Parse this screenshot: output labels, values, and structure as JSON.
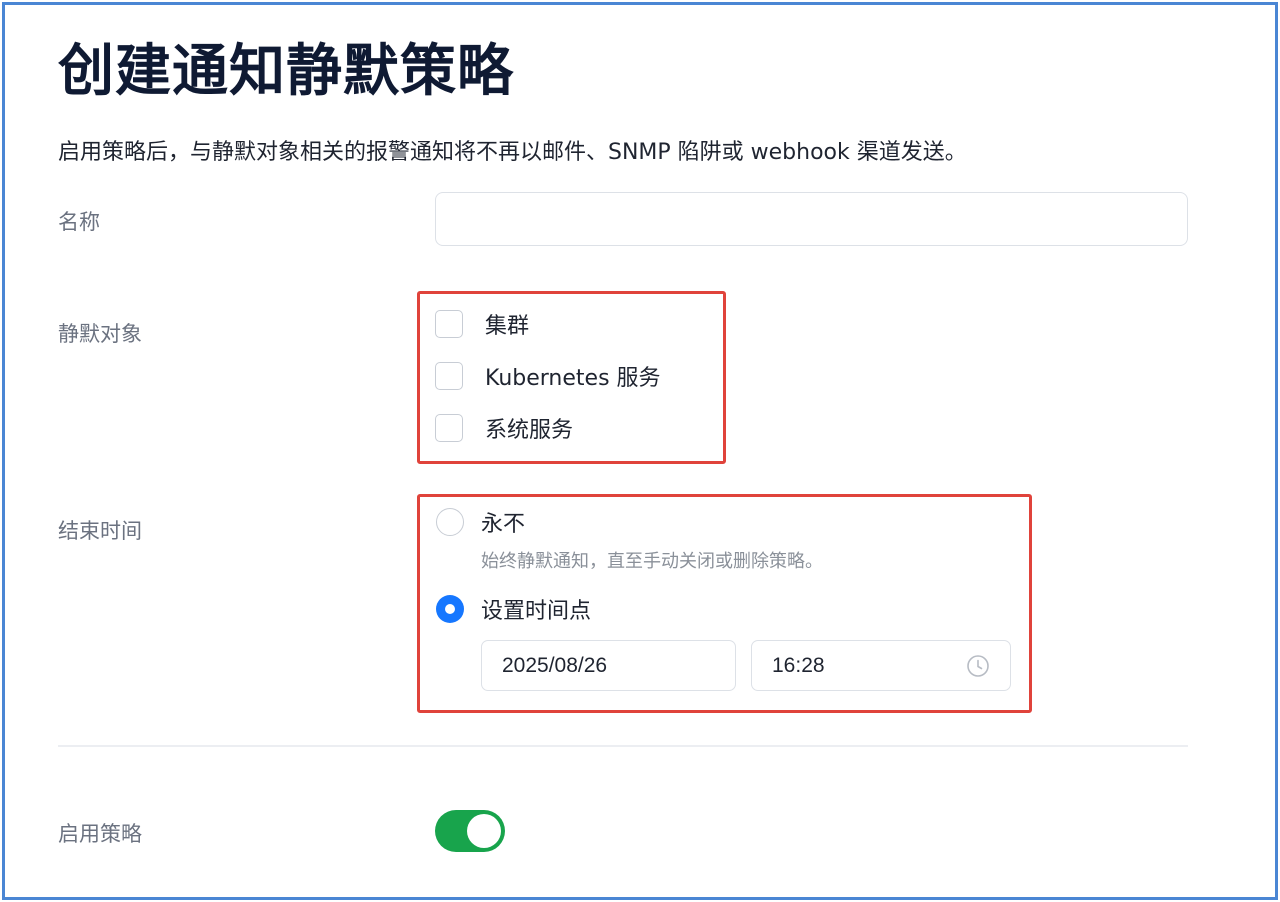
{
  "page": {
    "title": "创建通知静默策略",
    "description": "启用策略后，与静默对象相关的报警通知将不再以邮件、SNMP 陷阱或 webhook 渠道发送。"
  },
  "form": {
    "name_label": "名称",
    "name_value": "",
    "target_label": "静默对象",
    "targets": [
      {
        "label": "集群",
        "checked": false
      },
      {
        "label": "Kubernetes 服务",
        "checked": false
      },
      {
        "label": "系统服务",
        "checked": false
      }
    ],
    "end_time_label": "结束时间",
    "end_time_options": [
      {
        "label": "永不",
        "help": "始终静默通知，直至手动关闭或删除策略。",
        "selected": false
      },
      {
        "label": "设置时间点",
        "selected": true
      }
    ],
    "date_value": "2025/08/26",
    "time_value": "16:28",
    "enable_label": "启用策略",
    "enabled": true
  },
  "colors": {
    "accent": "#1677ff",
    "toggle_on": "#18a44c",
    "annotation": "#e0433b",
    "frame": "#4a86d4"
  },
  "icons": {
    "time_field": "clock-icon"
  }
}
